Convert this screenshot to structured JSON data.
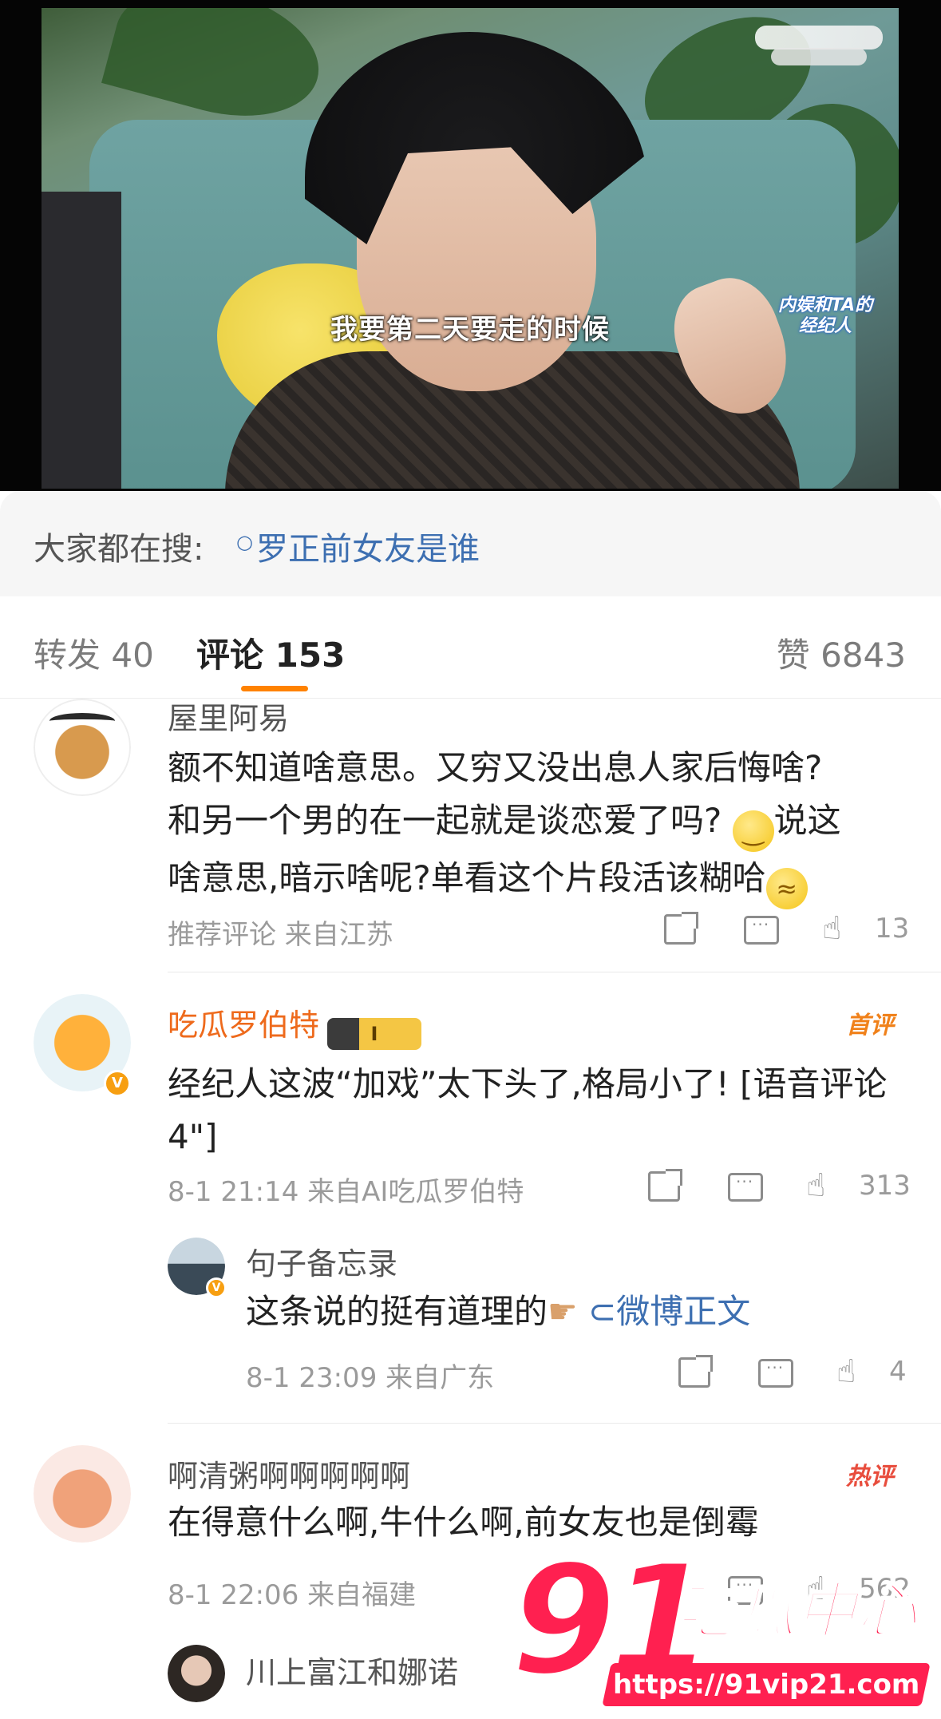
{
  "video": {
    "subtitle": "我要第二天要走的时候",
    "show_logo": "内娱和TA的经纪人"
  },
  "hot_search": {
    "prefix": "大家都在搜:",
    "query": "罗正前女友是谁"
  },
  "tabs": {
    "repost": "转发 40",
    "comments": "评论 153",
    "likes": "赞 6843"
  },
  "comments": [
    {
      "name": "屋里阿易",
      "text_1": "额不知道啥意思。又穷又没出息人家后悔啥?",
      "text_2a": "和另一个男的在一起就是谈恋爱了吗?",
      "text_2b": "说这",
      "text_3": "啥意思,暗示啥呢?单看这个片段活该糊哈",
      "meta": "推荐评论 来自江苏",
      "likes": "13"
    },
    {
      "name": "吃瓜罗伯特",
      "badge": "I",
      "tag": "首评",
      "text": "经纪人这波“加戏”太下头了,格局小了! [语音评论 4\"]",
      "meta": "8-1 21:14 来自AI吃瓜罗伯特",
      "likes": "313"
    },
    {
      "name": "句子备忘录",
      "text": "这条说的挺有道理的",
      "link": "微博正文",
      "meta": "8-1 23:09 来自广东",
      "likes": "4"
    },
    {
      "name": "啊清粥啊啊啊啊啊",
      "tag": "热评",
      "text": "在得意什么啊,牛什么啊,前女友也是倒霉",
      "meta": "8-1 22:06 来自福建",
      "likes": "562"
    },
    {
      "name": "川上富江和娜诺"
    }
  ],
  "watermark": {
    "number": "91",
    "brand": "吃瓜中心",
    "url": "https://91vip21.com"
  },
  "colors": {
    "accent": "#ff8200",
    "link": "#3d6fb1",
    "username_orange": "#ee6a1c",
    "watermark": "#ff2050"
  }
}
